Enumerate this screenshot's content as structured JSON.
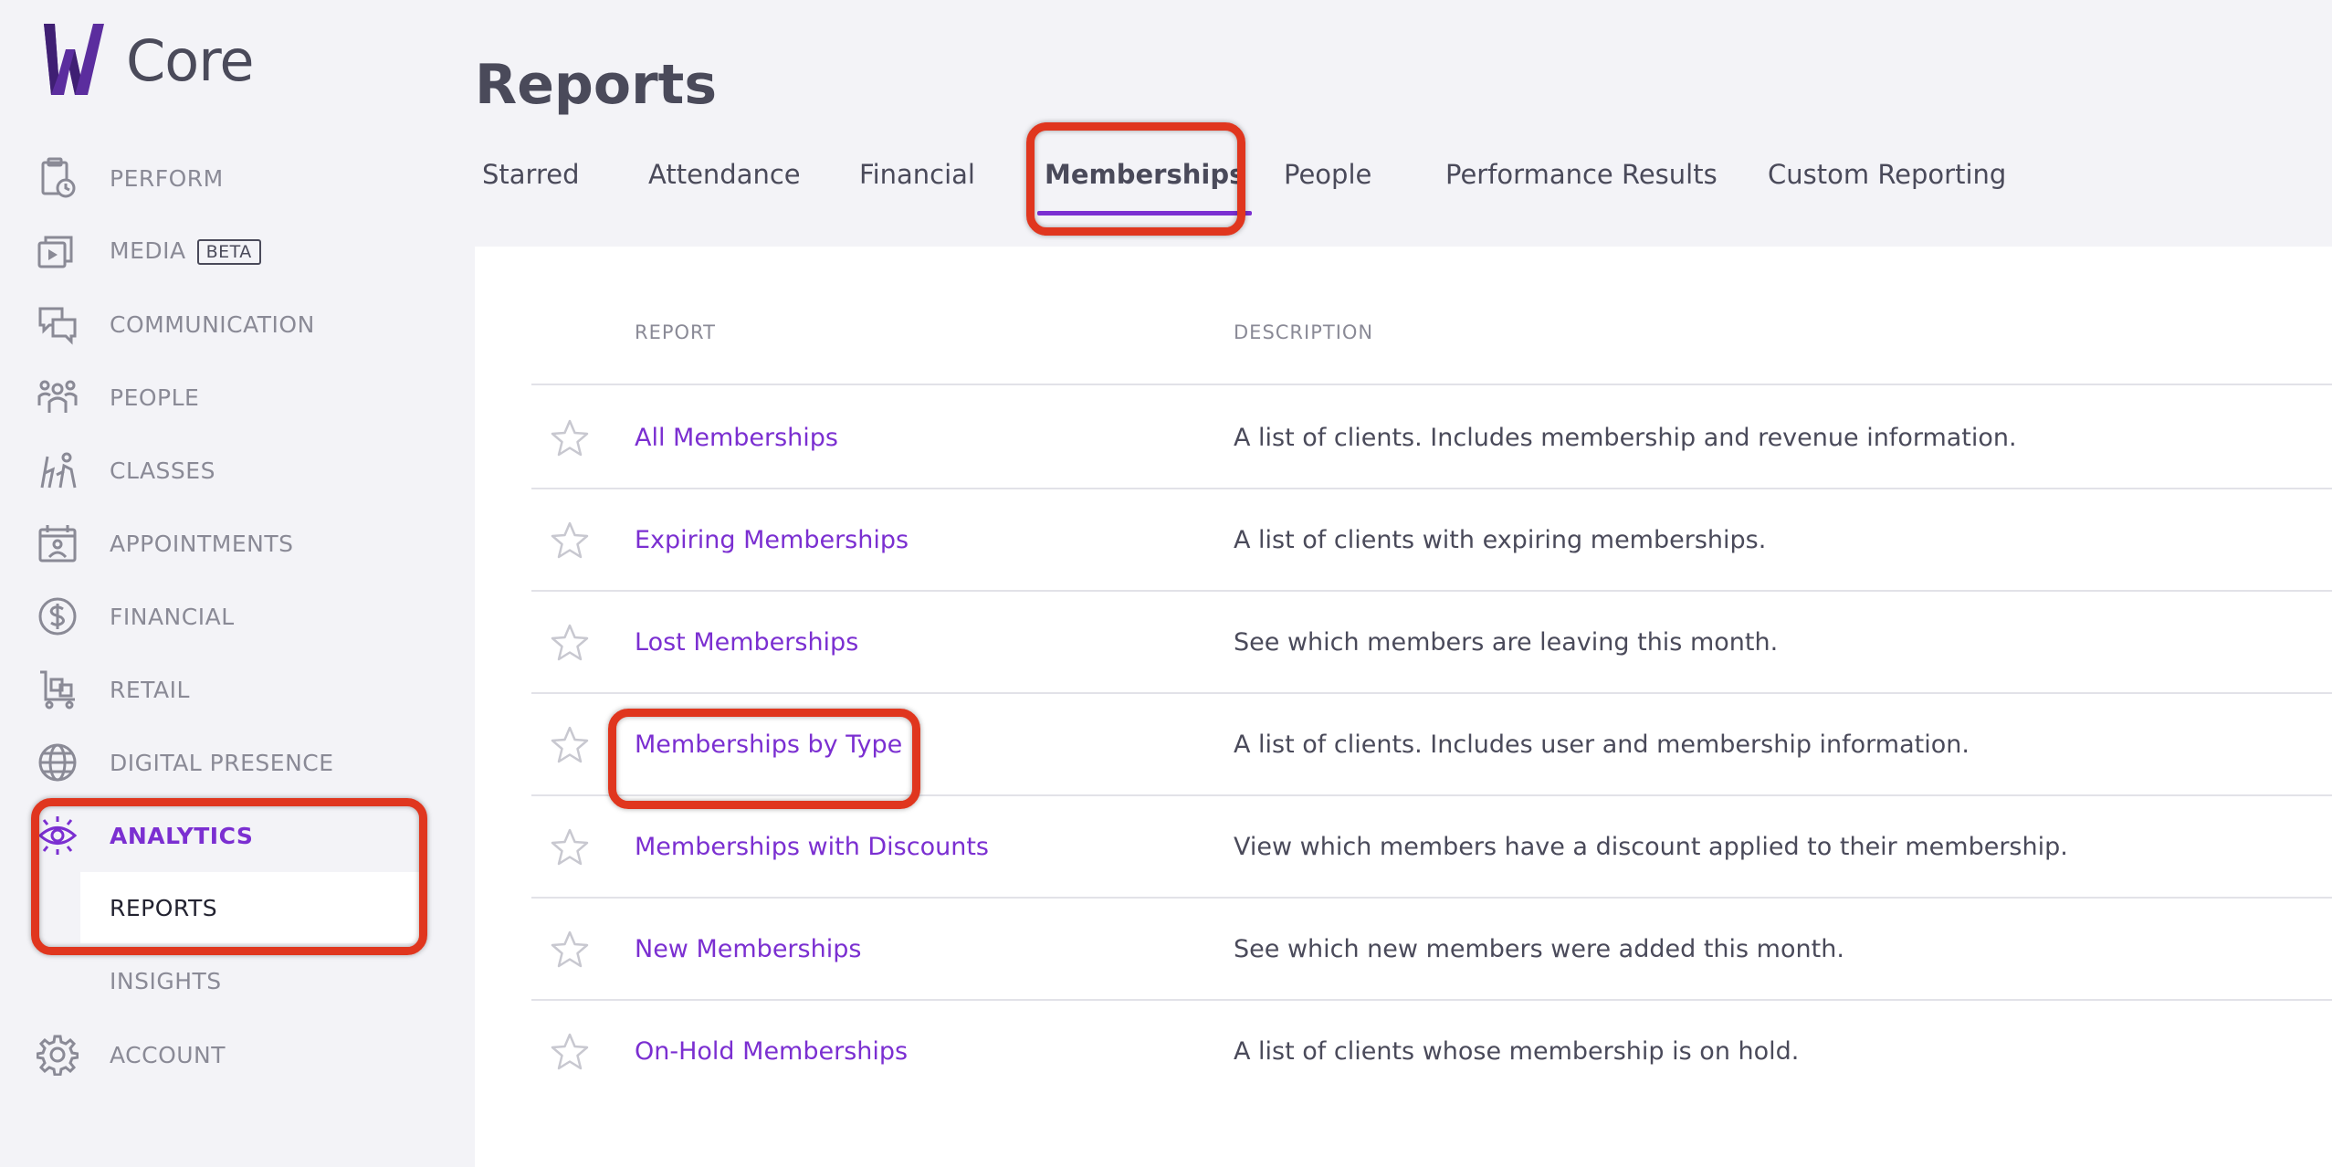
{
  "app": {
    "logo_text": "Core",
    "accent_color": "#7b2fd1",
    "highlight_color": "#e0361e"
  },
  "sidebar": {
    "items": [
      {
        "label": "PERFORM",
        "icon": "clipboard-clock-icon"
      },
      {
        "label": "MEDIA",
        "icon": "media-play-icon",
        "badge": "BETA"
      },
      {
        "label": "COMMUNICATION",
        "icon": "chat-bubbles-icon"
      },
      {
        "label": "PEOPLE",
        "icon": "people-group-icon"
      },
      {
        "label": "CLASSES",
        "icon": "class-figures-icon"
      },
      {
        "label": "APPOINTMENTS",
        "icon": "calendar-person-icon"
      },
      {
        "label": "FINANCIAL",
        "icon": "dollar-circle-icon"
      },
      {
        "label": "RETAIL",
        "icon": "cart-icon"
      },
      {
        "label": "DIGITAL PRESENCE",
        "icon": "globe-icon"
      },
      {
        "label": "ANALYTICS",
        "icon": "eye-icon",
        "active": true
      },
      {
        "label": "ACCOUNT",
        "icon": "gear-icon"
      }
    ],
    "analytics_sub": [
      {
        "label": "REPORTS",
        "selected": true
      },
      {
        "label": "INSIGHTS",
        "selected": false
      }
    ]
  },
  "main": {
    "title": "Reports",
    "tabs": [
      {
        "label": "Starred"
      },
      {
        "label": "Attendance"
      },
      {
        "label": "Financial"
      },
      {
        "label": "Memberships",
        "active": true
      },
      {
        "label": "People"
      },
      {
        "label": "Performance Results"
      },
      {
        "label": "Custom Reporting"
      }
    ],
    "table": {
      "columns": [
        "REPORT",
        "DESCRIPTION"
      ],
      "rows": [
        {
          "report": "All Memberships",
          "description": "A list of clients. Includes membership and revenue information."
        },
        {
          "report": "Expiring Memberships",
          "description": "A list of clients with expiring memberships."
        },
        {
          "report": "Lost Memberships",
          "description": "See which members are leaving this month."
        },
        {
          "report": "Memberships by Type",
          "description": "A list of clients. Includes user and membership information."
        },
        {
          "report": "Memberships with Discounts",
          "description": "View which members have a discount applied to their membership."
        },
        {
          "report": "New Memberships",
          "description": "See which new members were added this month."
        },
        {
          "report": "On-Hold Memberships",
          "description": "A list of clients whose membership is on hold."
        }
      ]
    }
  }
}
